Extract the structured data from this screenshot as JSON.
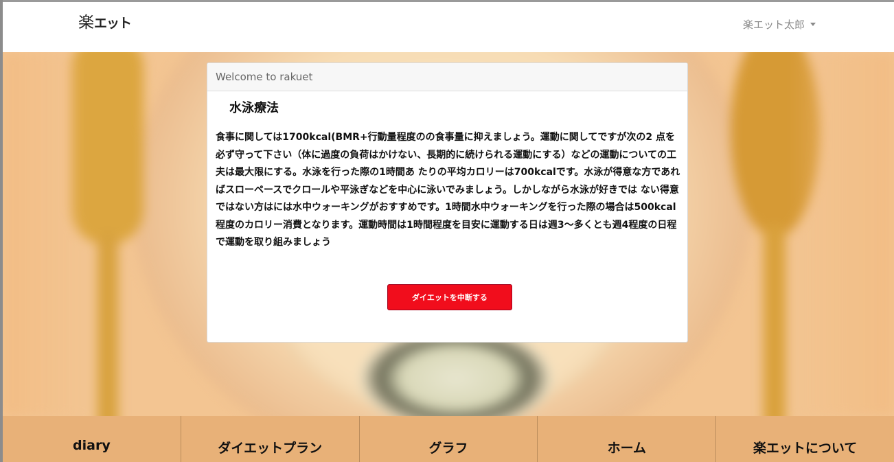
{
  "navbar": {
    "brand_kanji": "楽",
    "brand_kana": "エット",
    "user_name": "楽エット太郎"
  },
  "card": {
    "header": "Welcome to rakuet",
    "title": "水泳療法",
    "body": "食事に関しては1700kcal(BMR+行動量程度のの食事量に抑えましょう。運動に関してですが次の2 点を必ず守って下さい（体に過度の負荷はかけない、長期的に続けられる運動にする）などの運動についての工夫は最大限にする。水泳を行った際の1時間あ たりの平均カロリーは700kcalです。水泳が得意な方であればスローペースでクロールや平泳ぎなどを中心に泳いでみましょう。しかしながら水泳が好きでは ない得意ではない方はには水中ウォーキングがおすすめです。1時間水中ウォーキングを行った際の場合は500kcal程度のカロリー消費となります。運動時間は1時間程度を目安に運動する日は週3〜多くとも週4程度の日程で運動を取り組みましょう",
    "button_label": "ダイエットを中断する"
  },
  "bottom_nav": {
    "items": [
      {
        "label": "diary"
      },
      {
        "label": "ダイエットプラン"
      },
      {
        "label": "グラフ"
      },
      {
        "label": "ホーム"
      },
      {
        "label": "楽エットについて"
      }
    ]
  },
  "colors": {
    "button": "#f10d1c",
    "bottom_nav": "#e8b178",
    "hero": "#f3c592"
  },
  "icons": {
    "user_menu": "caret-down-icon"
  }
}
